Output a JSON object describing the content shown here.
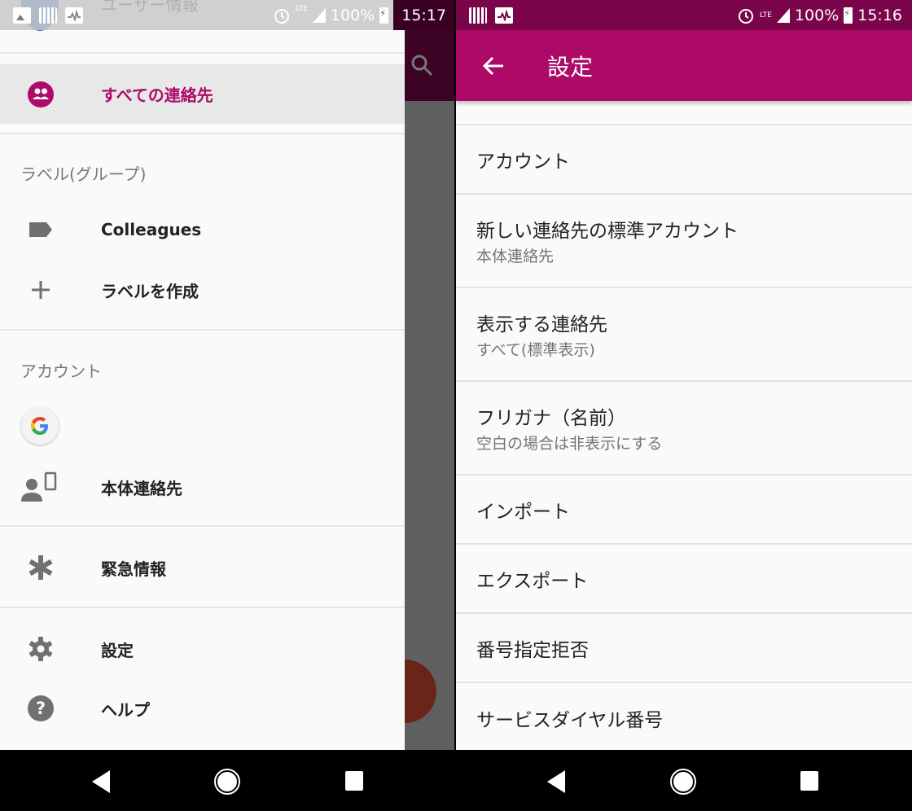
{
  "left_screen": {
    "status_bar": {
      "notification_icons": [
        "photo-icon",
        "grid-app-icon",
        "pulse-icon"
      ],
      "alarm_icon": "alarm-icon",
      "network": "LTE",
      "battery": "100%",
      "time": "15:17"
    },
    "drawer": {
      "header_name": "ユーザー情報",
      "items_top": [
        {
          "label": "すべての連絡先",
          "icon": "people-icon",
          "active": true
        }
      ],
      "labels_section": {
        "title": "ラベル(グループ)",
        "items": [
          {
            "label": "Colleagues",
            "icon": "label-icon"
          },
          {
            "label": "ラベルを作成",
            "icon": "plus-icon"
          }
        ]
      },
      "accounts_section": {
        "title": "アカウント",
        "items": [
          {
            "label": "",
            "icon": "google-icon"
          },
          {
            "label": "本体連絡先",
            "icon": "device-contacts-icon"
          }
        ]
      },
      "items_bottom": [
        {
          "label": "緊急情報",
          "icon": "asterisk-icon"
        },
        {
          "label": "設定",
          "icon": "gear-icon"
        },
        {
          "label": "ヘルプ",
          "icon": "help-icon"
        }
      ]
    },
    "accent_color": "#ad0a6a"
  },
  "right_screen": {
    "status_bar": {
      "notification_icons": [
        "grid-app-icon",
        "pulse-icon"
      ],
      "alarm_icon": "alarm-icon",
      "network": "LTE",
      "battery": "100%",
      "time": "15:16"
    },
    "appbar": {
      "title": "設定",
      "color": "#ad0a67"
    },
    "settings": [
      {
        "title": "アカウント",
        "subtitle": ""
      },
      {
        "title": "新しい連絡先の標準アカウント",
        "subtitle": "本体連絡先"
      },
      {
        "title": "表示する連絡先",
        "subtitle": "すべて(標準表示)"
      },
      {
        "title": "フリガナ（名前）",
        "subtitle": "空白の場合は非表示にする"
      },
      {
        "title": "インポート",
        "subtitle": ""
      },
      {
        "title": "エクスポート",
        "subtitle": ""
      },
      {
        "title": "番号指定拒否",
        "subtitle": ""
      },
      {
        "title": "サービスダイヤル番号",
        "subtitle": ""
      }
    ]
  },
  "navbar": {
    "buttons": [
      "back",
      "home",
      "recents"
    ]
  }
}
